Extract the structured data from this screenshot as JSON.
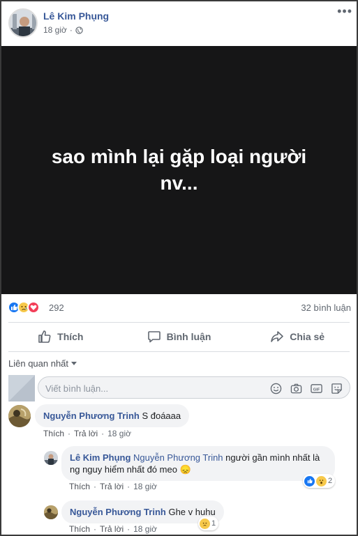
{
  "post": {
    "author": "Lê Kim Phụng",
    "time": "18 giờ",
    "separator": "·",
    "more": "•••",
    "image_text": "sao mình lại gặp loại người nv...",
    "reaction_count": "292",
    "comments_count": "32 bình luận"
  },
  "actions": {
    "like": "Thích",
    "comment": "Bình luận",
    "share": "Chia sẻ"
  },
  "sort_label": "Liên quan nhất",
  "comment_box": {
    "placeholder": "Viết bình luận..."
  },
  "comments": [
    {
      "name": "Nguyễn Phương Trinh",
      "text": "S đoáaaa",
      "like": "Thích",
      "reply": "Trả lời",
      "time": "18 giờ"
    },
    {
      "name": "Lê Kim Phụng",
      "mention": "Nguyễn Phương Trinh",
      "text": "người gần mình nhất là ng nguy hiểm nhất đó meo",
      "emoji": "😞",
      "like": "Thích",
      "reply": "Trả lời",
      "time": "18 giờ",
      "reaction_count": "2"
    },
    {
      "name": "Nguyễn Phương Trinh",
      "text": "Ghe v huhu",
      "like": "Thích",
      "reply": "Trả lời",
      "time": "18 giờ",
      "reaction_count": "1"
    }
  ],
  "colors": {
    "name_blue": "#385898",
    "like_blue": "#1877f2",
    "love_red": "#f33e58",
    "image_bg": "#161617"
  }
}
